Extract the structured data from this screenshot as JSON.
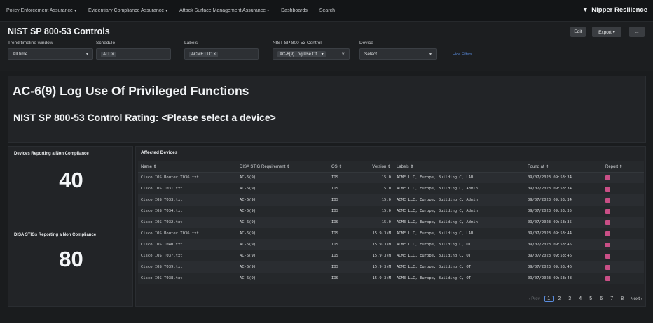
{
  "nav": {
    "items": [
      {
        "label": "Policy Enforcement Assurance",
        "caret": true
      },
      {
        "label": "Evidentiary Compliance Assurance",
        "caret": true
      },
      {
        "label": "Attack Surface Management Assurance",
        "caret": true
      },
      {
        "label": "Dashboards",
        "caret": false
      },
      {
        "label": "Search",
        "caret": false
      }
    ],
    "brand": "Nipper Resilience",
    "brand_icon": "▼"
  },
  "header": {
    "title": "NIST SP 800-53 Controls",
    "edit": "Edit",
    "export": "Export ▾",
    "more": "..."
  },
  "filters": {
    "trend_label": "Trend timeline window",
    "trend_value": "All time",
    "schedule_label": "Schedule",
    "schedule_tag": "ALL ×",
    "labels_label": "Labels",
    "labels_tag": "ACME LLC ×",
    "control_label": "NIST SP 800-53 Control",
    "control_value": "AC-6(9) Log Use Of... ▾",
    "control_clear": "×",
    "device_label": "Device",
    "device_value": "Select...",
    "hide_filters": "Hide Filters"
  },
  "control": {
    "title": "AC-6(9) Log Use Of Privileged Functions",
    "rating": "NIST SP 800-53 Control Rating: <Please select a device>"
  },
  "kpis": {
    "devices_label": "Devices Reporting a Non Compliance",
    "devices_value": "40",
    "stigs_label": "DISA STIGs Reporting a Non Compliance",
    "stigs_value": "80"
  },
  "table": {
    "title": "Affected Devices",
    "columns": [
      "Name ⇕",
      "DISA STIG Requirement ⇕",
      "OS ⇕",
      "Version ⇕",
      "Labels ⇕",
      "Found at ⇕",
      "Report ⇕"
    ],
    "rows": [
      [
        "Cisco IOS Router T036.txt",
        "AC-6(9)",
        "IOS",
        "15.0",
        "ACME LLC, Europe, Building C, LAB",
        "09/07/2023 09:53:34"
      ],
      [
        "Cisco IOS T031.txt",
        "AC-6(9)",
        "IOS",
        "15.0",
        "ACME LLC, Europe, Building C, Admin",
        "09/07/2023 09:53:34"
      ],
      [
        "Cisco IOS T033.txt",
        "AC-6(9)",
        "IOS",
        "15.0",
        "ACME LLC, Europe, Building C, Admin",
        "09/07/2023 09:53:34"
      ],
      [
        "Cisco IOS T034.txt",
        "AC-6(9)",
        "IOS",
        "15.0",
        "ACME LLC, Europe, Building C, Admin",
        "09/07/2023 09:53:35"
      ],
      [
        "Cisco IOS T032.txt",
        "AC-6(9)",
        "IOS",
        "15.0",
        "ACME LLC, Europe, Building C, Admin",
        "09/07/2023 09:53:35"
      ],
      [
        "Cisco IOS Router T036.txt",
        "AC-6(9)",
        "IOS",
        "15.9(3)M",
        "ACME LLC, Europe, Building C, LAB",
        "09/07/2023 09:53:44"
      ],
      [
        "Cisco IOS T040.txt",
        "AC-6(9)",
        "IOS",
        "15.9(3)M",
        "ACME LLC, Europe, Building C, OT",
        "09/07/2023 09:53:45"
      ],
      [
        "Cisco IOS T037.txt",
        "AC-6(9)",
        "IOS",
        "15.9(3)M",
        "ACME LLC, Europe, Building C, OT",
        "09/07/2023 09:53:46"
      ],
      [
        "Cisco IOS T039.txt",
        "AC-6(9)",
        "IOS",
        "15.9(3)M",
        "ACME LLC, Europe, Building C, OT",
        "09/07/2023 09:53:46"
      ],
      [
        "Cisco IOS T038.txt",
        "AC-6(9)",
        "IOS",
        "15.9(3)M",
        "ACME LLC, Europe, Building C, OT",
        "09/07/2023 09:53:48"
      ]
    ]
  },
  "pager": {
    "prev": "‹ Prev",
    "pages": [
      "1",
      "2",
      "3",
      "4",
      "5",
      "6",
      "7",
      "8"
    ],
    "active": "1",
    "next": "Next ›"
  },
  "colors": {
    "accent": "#5a8de0",
    "report_icon": "#c94f86"
  }
}
